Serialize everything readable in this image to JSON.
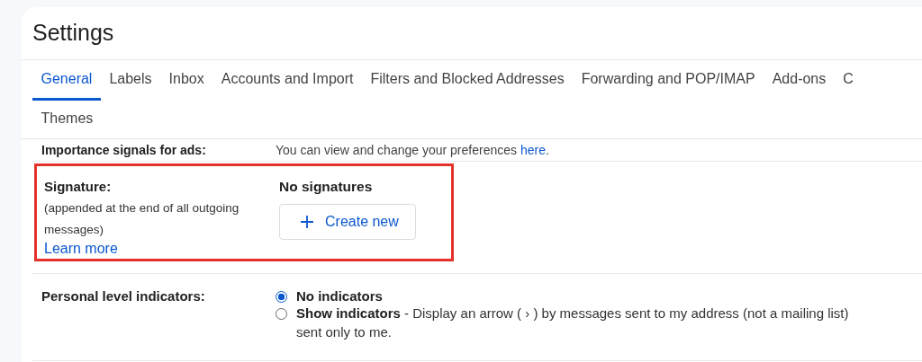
{
  "page": {
    "title": "Settings"
  },
  "tabs": [
    {
      "label": "General",
      "selected": true
    },
    {
      "label": "Labels",
      "selected": false
    },
    {
      "label": "Inbox",
      "selected": false
    },
    {
      "label": "Accounts and Import",
      "selected": false
    },
    {
      "label": "Filters and Blocked Addresses",
      "selected": false
    },
    {
      "label": "Forwarding and POP/IMAP",
      "selected": false
    },
    {
      "label": "Add-ons",
      "selected": false
    },
    {
      "label": "C",
      "selected": false
    },
    {
      "label": "Themes",
      "selected": false
    }
  ],
  "importance_row": {
    "label": "Importance signals for ads:",
    "text": "You can view and change your preferences ",
    "link": "here",
    "after": "."
  },
  "signature": {
    "label": "Signature:",
    "note": "(appended at the end of all outgoing messages)",
    "learn_more": "Learn more",
    "status": "No signatures",
    "button": "Create new",
    "highlighted": true
  },
  "indicators": {
    "label": "Personal level indicators:",
    "options": [
      {
        "text": "**No indicators**",
        "selected": true
      },
      {
        "text": "**Show indicators** - Display an arrow ( › ) by messages sent to my address (not a mailing list)",
        "continuation": "sent only to me.",
        "selected": false
      }
    ]
  }
}
